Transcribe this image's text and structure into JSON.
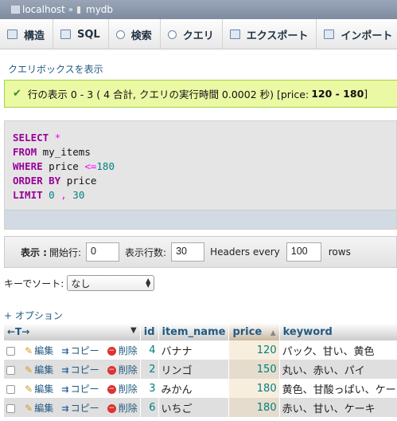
{
  "breadcrumb": {
    "server": "localhost",
    "separator": "»",
    "database": "mydb"
  },
  "tabs": [
    {
      "label": "構造"
    },
    {
      "label": "SQL"
    },
    {
      "label": "検索"
    },
    {
      "label": "クエリ"
    },
    {
      "label": "エクスポート"
    },
    {
      "label": "インポート"
    }
  ],
  "show_query_link": "クエリボックスを表示",
  "message": {
    "text": "行の表示 0 - 3 ( 4 合計, クエリの実行時間 0.0002 秒) [price: ",
    "range": "120 - 180",
    "close": "]"
  },
  "sql": {
    "select_kw": "SELECT",
    "select_val": "*",
    "from_kw": "FROM",
    "from_val": "my_items",
    "where_kw": "WHERE",
    "where_col": "price",
    "where_op": "<=",
    "where_val": "180",
    "order_kw": "ORDER BY",
    "order_val": "price",
    "limit_kw": "LIMIT",
    "limit_offset": "0",
    "limit_sep": ",",
    "limit_count": "30"
  },
  "nav": {
    "show_label": "表示 :",
    "start_label": "開始行:",
    "start_value": "0",
    "rows_label": "表示行数:",
    "rows_value": "30",
    "headers_label": "Headers every",
    "headers_value": "100",
    "rows_suffix": "rows"
  },
  "sort": {
    "label": "キーでソート:",
    "selected": "なし"
  },
  "options_link": "+ オプション",
  "table": {
    "arrows": "←T→",
    "sort_marker": "▼",
    "columns": [
      "id",
      "item_name",
      "price",
      "keyword"
    ],
    "actions": {
      "edit": "編集",
      "copy": "コピー",
      "delete": "削除"
    },
    "rows": [
      {
        "id": "4",
        "item_name": "バナナ",
        "price": "120",
        "keyword": "パック、甘い、黄色"
      },
      {
        "id": "2",
        "item_name": "リンゴ",
        "price": "150",
        "keyword": "丸い、赤い、パイ"
      },
      {
        "id": "3",
        "item_name": "みかん",
        "price": "180",
        "keyword": "黄色、甘酸っぱい、ケーキ"
      },
      {
        "id": "6",
        "item_name": "いちご",
        "price": "180",
        "keyword": "赤い、甘い、ケーキ"
      }
    ]
  },
  "colors": {
    "link": "#235a81",
    "success_bg": "#ebf8a4",
    "keyword": "#990099"
  }
}
